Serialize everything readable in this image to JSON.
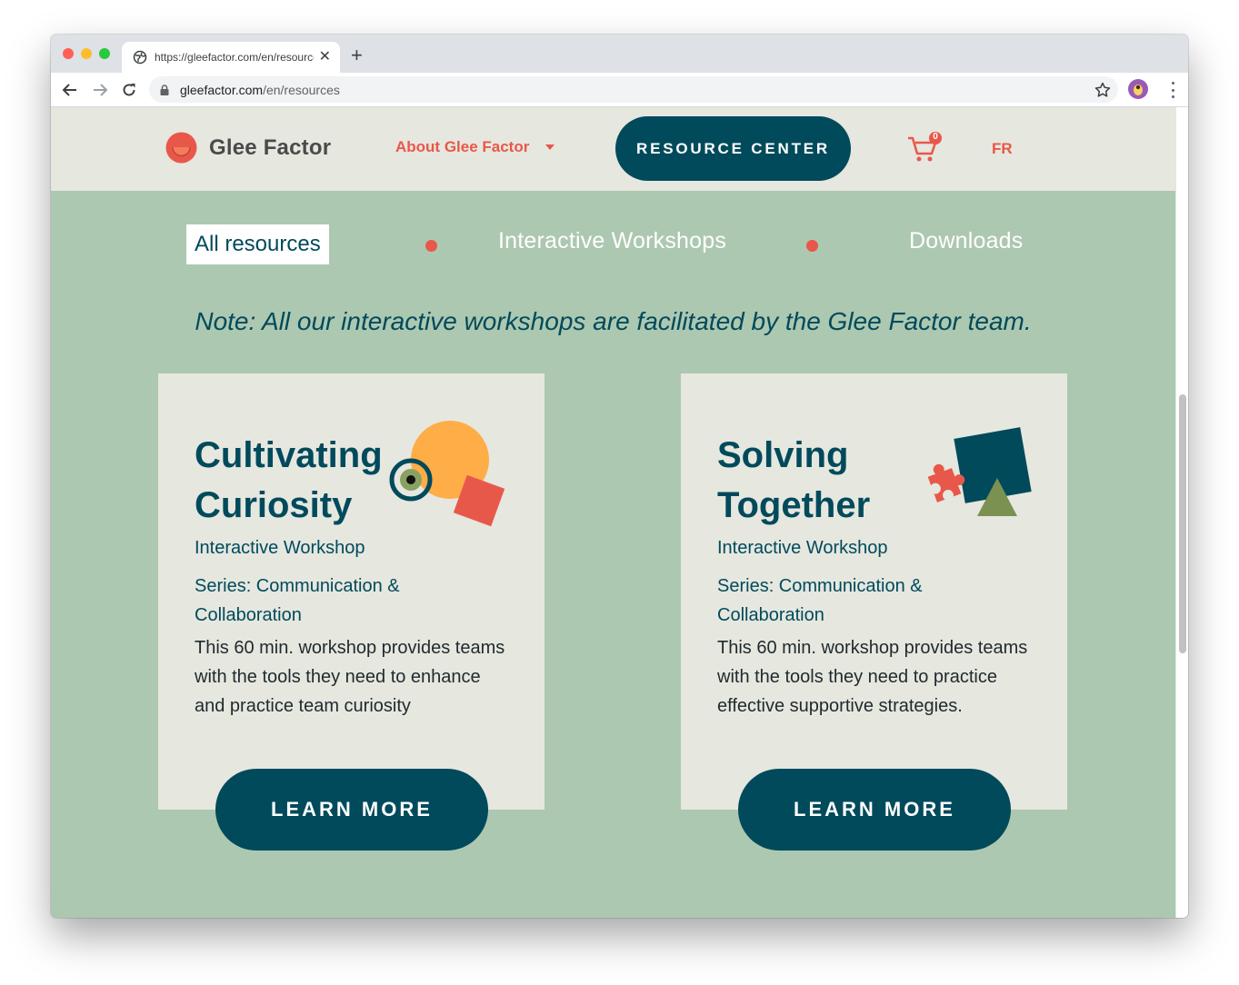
{
  "browser": {
    "tab_title": "https://gleefactor.com/en/resources",
    "new_tab_glyph": "+",
    "close_glyph": "✕",
    "url_domain": "gleefactor.com",
    "url_path": "/en/resources"
  },
  "header": {
    "logo_text": "Glee Factor",
    "about_label": "About Glee Factor",
    "resource_center_label": "RESOURCE CENTER",
    "cart_count": "0",
    "lang_label": "FR"
  },
  "filters": {
    "all": "All resources",
    "workshops": "Interactive Workshops",
    "downloads": "Downloads"
  },
  "note": "Note: All our interactive workshops are facilitated by the Glee Factor team.",
  "cards": [
    {
      "title": "Cultivating Curiosity",
      "type": "Interactive Workshop",
      "series": "Series: Communication & Collaboration",
      "description": "This 60 min. workshop provides teams with the tools they need to enhance and practice team curiosity",
      "button": "LEARN MORE"
    },
    {
      "title": "Solving Together",
      "type": "Interactive Workshop",
      "series": "Series: Communication & Collaboration",
      "description": "This 60 min. workshop provides teams with the tools they need to practice effective supportive strategies.",
      "button": "LEARN MORE"
    }
  ],
  "colors": {
    "brand_teal": "#004a5c",
    "brand_coral": "#e8584a",
    "page_green": "#adc8b0",
    "card_bg": "#e6e7df",
    "accent_orange": "#ffad47",
    "accent_olive": "#7a9152"
  }
}
